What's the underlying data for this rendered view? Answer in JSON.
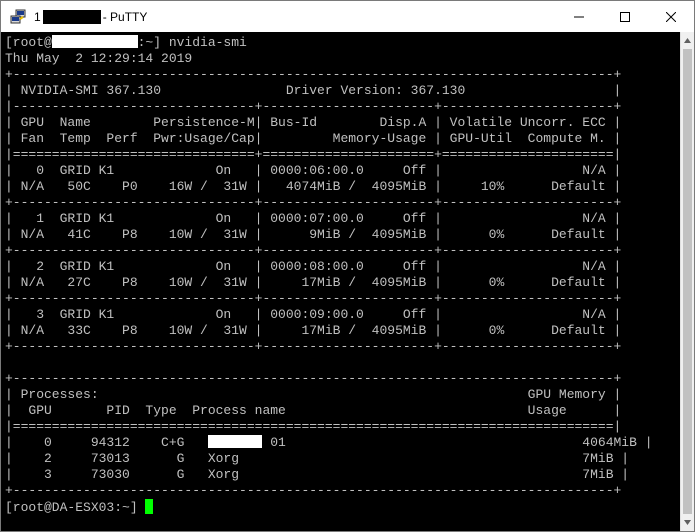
{
  "window": {
    "title_prefix": "1",
    "app_name": "- PuTTY",
    "icons": {
      "app": "putty-icon",
      "minimize": "minimize-icon",
      "maximize": "maximize-icon",
      "close": "close-icon"
    }
  },
  "terminal": {
    "lines": [
      {
        "pre": "[root@",
        "redact": 11,
        "post": ":~] nvidia-smi"
      },
      {
        "text": "Thu May  2 12:29:14 2019"
      },
      {
        "text": "+-----------------------------------------------------------------------------+"
      },
      {
        "text": "| NVIDIA-SMI 367.130                Driver Version: 367.130                   |"
      },
      {
        "text": "|-------------------------------+----------------------+----------------------+"
      },
      {
        "text": "| GPU  Name        Persistence-M| Bus-Id        Disp.A | Volatile Uncorr. ECC |"
      },
      {
        "text": "| Fan  Temp  Perf  Pwr:Usage/Cap|         Memory-Usage | GPU-Util  Compute M. |"
      },
      {
        "text": "|===============================+======================+======================|"
      },
      {
        "text": "|   0  GRID K1             On   | 0000:06:00.0     Off |                  N/A |"
      },
      {
        "text": "| N/A   50C    P0    16W /  31W |   4074MiB /  4095MiB |     10%      Default |"
      },
      {
        "text": "+-------------------------------+----------------------+----------------------+"
      },
      {
        "text": "|   1  GRID K1             On   | 0000:07:00.0     Off |                  N/A |"
      },
      {
        "text": "| N/A   41C    P8    10W /  31W |      9MiB /  4095MiB |      0%      Default |"
      },
      {
        "text": "+-------------------------------+----------------------+----------------------+"
      },
      {
        "text": "|   2  GRID K1             On   | 0000:08:00.0     Off |                  N/A |"
      },
      {
        "text": "| N/A   27C    P8    10W /  31W |     17MiB /  4095MiB |      0%      Default |"
      },
      {
        "text": "+-------------------------------+----------------------+----------------------+"
      },
      {
        "text": "|   3  GRID K1             On   | 0000:09:00.0     Off |                  N/A |"
      },
      {
        "text": "| N/A   33C    P8    10W /  31W |     17MiB /  4095MiB |      0%      Default |"
      },
      {
        "text": "+-------------------------------+----------------------+----------------------+"
      },
      {
        "text": ""
      },
      {
        "text": "+-----------------------------------------------------------------------------+"
      },
      {
        "text": "| Processes:                                                       GPU Memory |"
      },
      {
        "text": "|  GPU       PID  Type  Process name                               Usage      |"
      },
      {
        "text": "|=============================================================================|"
      },
      {
        "pre": "|    0     94312    C+G   ",
        "redact": 7,
        "post": " 01                                      4064MiB |"
      },
      {
        "text": "|    2     73013      G   Xorg                                            7MiB |"
      },
      {
        "text": "|    3     73030      G   Xorg                                            7MiB |"
      },
      {
        "text": "+-----------------------------------------------------------------------------+"
      },
      {
        "text": "[root@DA-ESX03:~] ",
        "cursor": true
      }
    ]
  },
  "scrollbar": {
    "up_icon": "scroll-up-arrow-icon",
    "down_icon": "scroll-down-arrow-icon"
  }
}
